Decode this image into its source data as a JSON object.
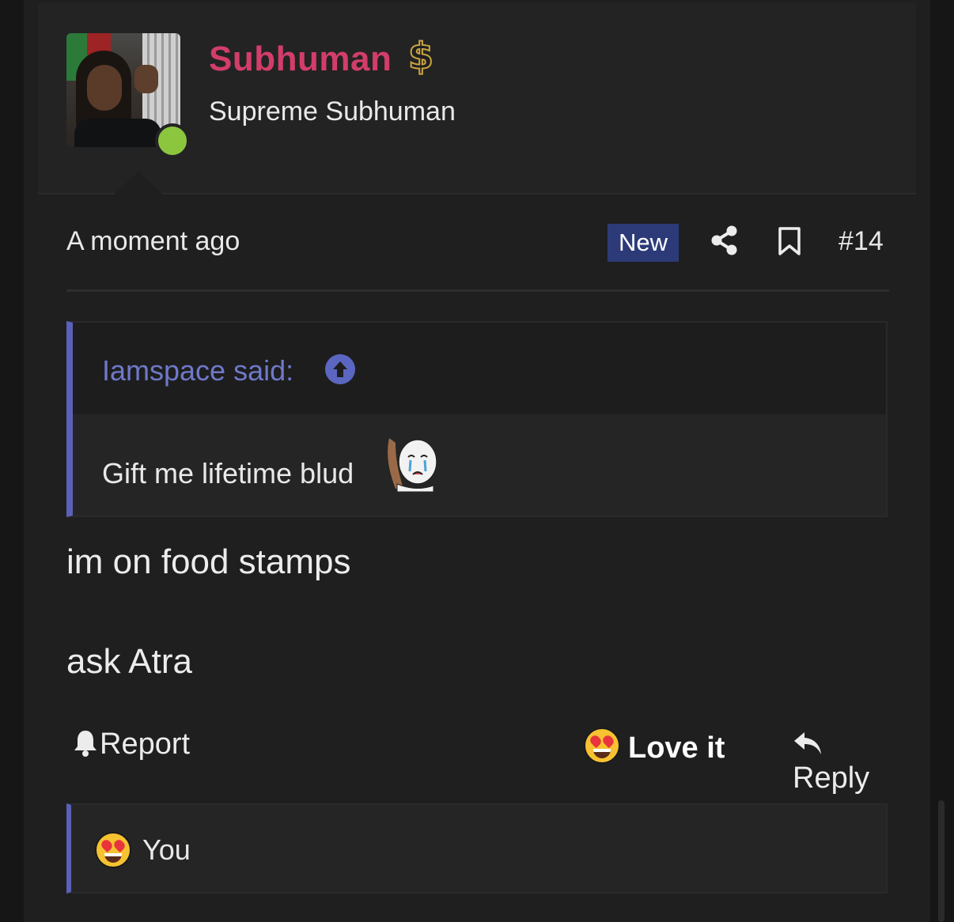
{
  "post": {
    "author": {
      "name": "Subhuman",
      "name_color": "#d33d6a",
      "badge_icon": "dollar-sign-icon",
      "title": "Supreme Subhuman",
      "online": true
    },
    "meta": {
      "timestamp": "A moment ago",
      "new_badge": "New",
      "post_number": "#14"
    },
    "quote": {
      "author_line": "Iamspace said:",
      "text": "Gift me lifetime blud"
    },
    "body": {
      "line1": "im on food stamps",
      "line2": "ask Atra"
    },
    "actions": {
      "report": "Report",
      "love": "Love it",
      "reply": "Reply"
    },
    "reactions": {
      "users": "You"
    }
  },
  "colors": {
    "accent": "#5b61b8",
    "new_badge_bg": "#2d3a78",
    "online": "#8cc63f"
  }
}
